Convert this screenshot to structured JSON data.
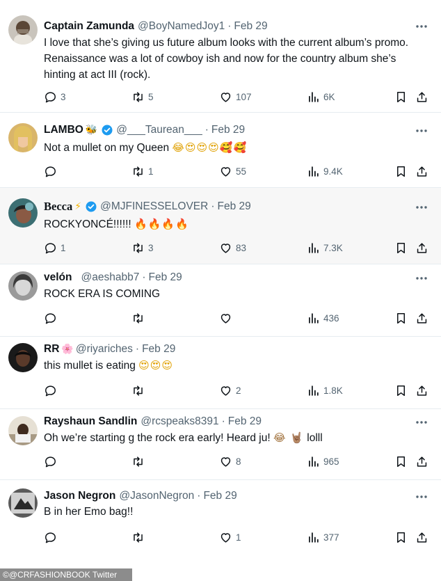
{
  "tweets": [
    {
      "name": "Captain Zamunda",
      "handle": "@BoyNamedJoy1",
      "date": "Feb 29",
      "text": "I love that she’s giving us future album looks with the current album’s promo. Renaissance was a lot of cowboy ish and now for the country album she’s hinting at act III (rock).",
      "replies": "3",
      "retweets": "5",
      "likes": "107",
      "views": "6K"
    },
    {
      "name": "LAMBO",
      "name_emoji": "🐝",
      "handle": "@___Taurean___",
      "date": "Feb 29",
      "verified": true,
      "text": "Not a  mullet on my Queen",
      "text_emoji": "😂😍😍😍🥰🥰",
      "replies": "",
      "retweets": "1",
      "likes": "55",
      "views": "9.4K"
    },
    {
      "name": "Becca",
      "name_emoji": "⚡",
      "handle": "@MJFINESSELOVER",
      "date": "Feb 29",
      "verified": true,
      "text": "ROCKYONCÉ!!!!!!",
      "text_emoji": "🔥🔥🔥🔥",
      "replies": "1",
      "retweets": "3",
      "likes": "83",
      "views": "7.3K"
    },
    {
      "name": "velón",
      "handle": "@aeshabb7",
      "date": "Feb 29",
      "text": "ROCK ERA IS COMING",
      "replies": "",
      "retweets": "",
      "likes": "",
      "views": "436"
    },
    {
      "name": "RR",
      "name_emoji": "🌸",
      "handle": "@riyariches",
      "date": "Feb 29",
      "text": "this mullet is eating",
      "text_emoji": "😍😍😍",
      "replies": "",
      "retweets": "",
      "likes": "2",
      "views": "1.8K"
    },
    {
      "name": "Rayshaun Sandlin",
      "handle": "@rcspeaks8391",
      "date": "Feb 29",
      "text": "Oh we’re starting g the rock era early! Heard ju!",
      "text_emoji": "😂 🤘🏽",
      "text_after": "lolll",
      "replies": "",
      "retweets": "",
      "likes": "8",
      "views": "965"
    },
    {
      "name": "Jason Negron",
      "handle": "@JasonNegron",
      "date": "Feb 29",
      "text": "B in her Emo bag!!",
      "replies": "",
      "retweets": "",
      "likes": "1",
      "views": "377"
    }
  ],
  "separator": "·",
  "watermark": "©@CRFASHIONBOOK Twitter",
  "colors": {
    "text": "#0f1419",
    "muted": "#536471",
    "verified": "#1d9bf0",
    "shaded_bg": "#f7f7f7"
  },
  "icons": [
    "reply-icon",
    "retweet-icon",
    "like-icon",
    "views-icon",
    "bookmark-icon",
    "share-icon",
    "more-icon",
    "verified-badge-icon"
  ]
}
